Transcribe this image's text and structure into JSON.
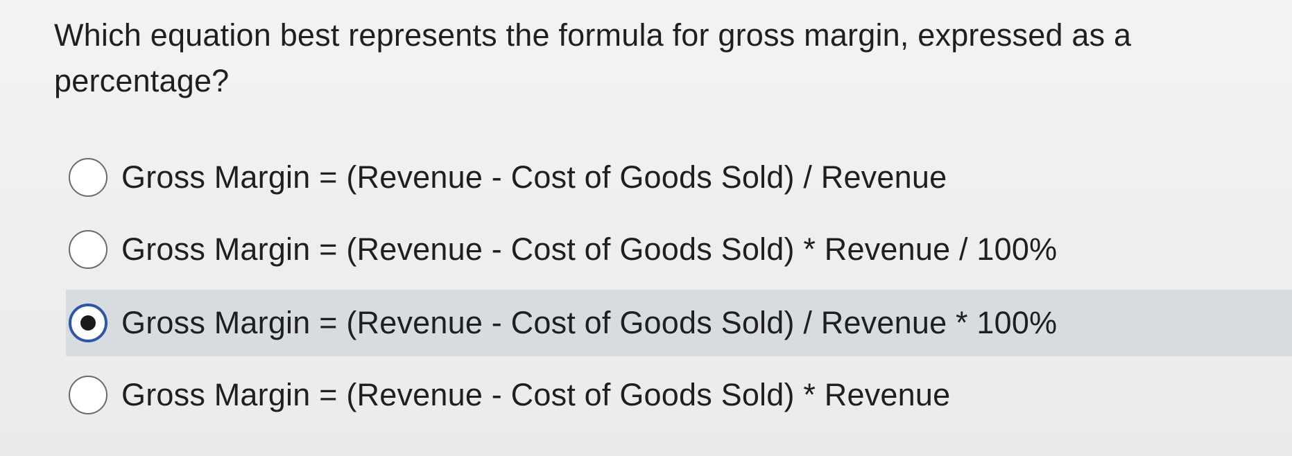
{
  "question": {
    "text": "Which equation best represents the formula for gross margin, expressed as a percentage?"
  },
  "options": [
    {
      "label": "Gross Margin = (Revenue - Cost of Goods Sold) / Revenue",
      "selected": false
    },
    {
      "label": "Gross Margin = (Revenue - Cost of Goods Sold) * Revenue / 100%",
      "selected": false
    },
    {
      "label": "Gross Margin = (Revenue - Cost of Goods Sold) / Revenue * 100%",
      "selected": true
    },
    {
      "label": "Gross Margin = (Revenue - Cost of Goods Sold) * Revenue",
      "selected": false
    }
  ],
  "colors": {
    "selected_radio": "#2d55a8",
    "selected_row_background": "#d7dce1"
  }
}
